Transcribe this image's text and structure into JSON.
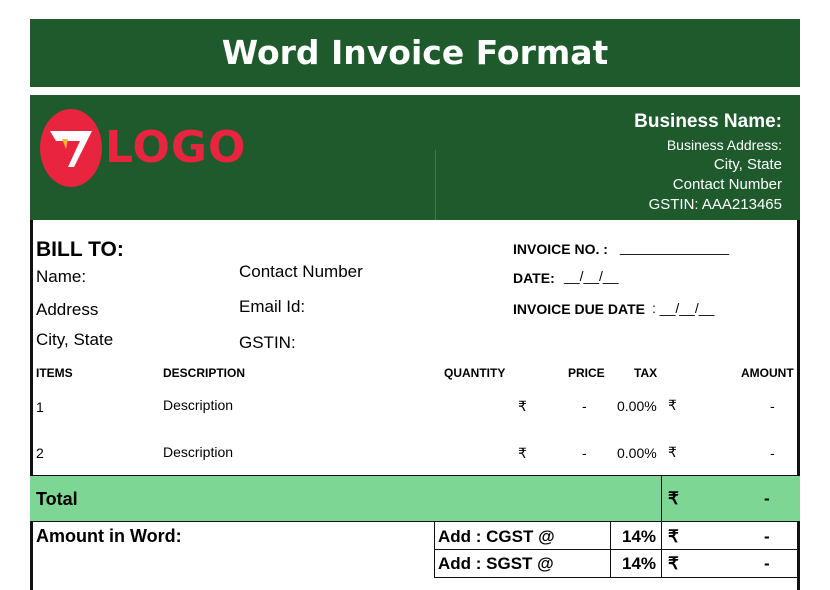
{
  "banner": {
    "title": "Word Invoice Format"
  },
  "logo": {
    "text": "LOGO"
  },
  "business": {
    "name": "Business Name:",
    "address": "Business Address:",
    "city": "City, State",
    "contact": "Contact Number",
    "gstin": "GSTIN: AAA213465"
  },
  "bill_to": {
    "heading": "BILL TO:",
    "name": "Name:",
    "address": "Address",
    "city": "City, State",
    "contact": "Contact Number",
    "email": "Email Id:",
    "gstin": "GSTIN:"
  },
  "invoice": {
    "no_label": "INVOICE NO. :",
    "no_value": "______________",
    "date_label": "DATE:",
    "date_value": "__/__/__",
    "due_label": "INVOICE DUE DATE",
    "due_value": ": __/__/__"
  },
  "table": {
    "headers": {
      "items": "ITEMS",
      "description": "DESCRIPTION",
      "quantity": "QUANTITY",
      "price": "PRICE",
      "tax": "TAX",
      "amount": "AMOUNT"
    },
    "rows": [
      {
        "item": "1",
        "description": "Description",
        "currency": "₹",
        "price": "-",
        "tax": "0.00%",
        "currency2": "₹",
        "amount": "-"
      },
      {
        "item": "2",
        "description": "Description",
        "currency": "₹",
        "price": "-",
        "tax": "0.00%",
        "currency2": "₹",
        "amount": "-"
      }
    ]
  },
  "total": {
    "label": "Total",
    "currency": "₹",
    "amount": "-"
  },
  "amount_in_word": "Amount in Word:",
  "taxes": [
    {
      "label": "Add : CGST @",
      "rate": "14%",
      "currency": "₹",
      "amount": "-"
    },
    {
      "label": "Add : SGST @",
      "rate": "14%",
      "currency": "₹",
      "amount": "-"
    }
  ],
  "colors": {
    "dark_green": "#1e5a2c",
    "light_green": "#7dd694",
    "logo_red": "#e8243f"
  }
}
